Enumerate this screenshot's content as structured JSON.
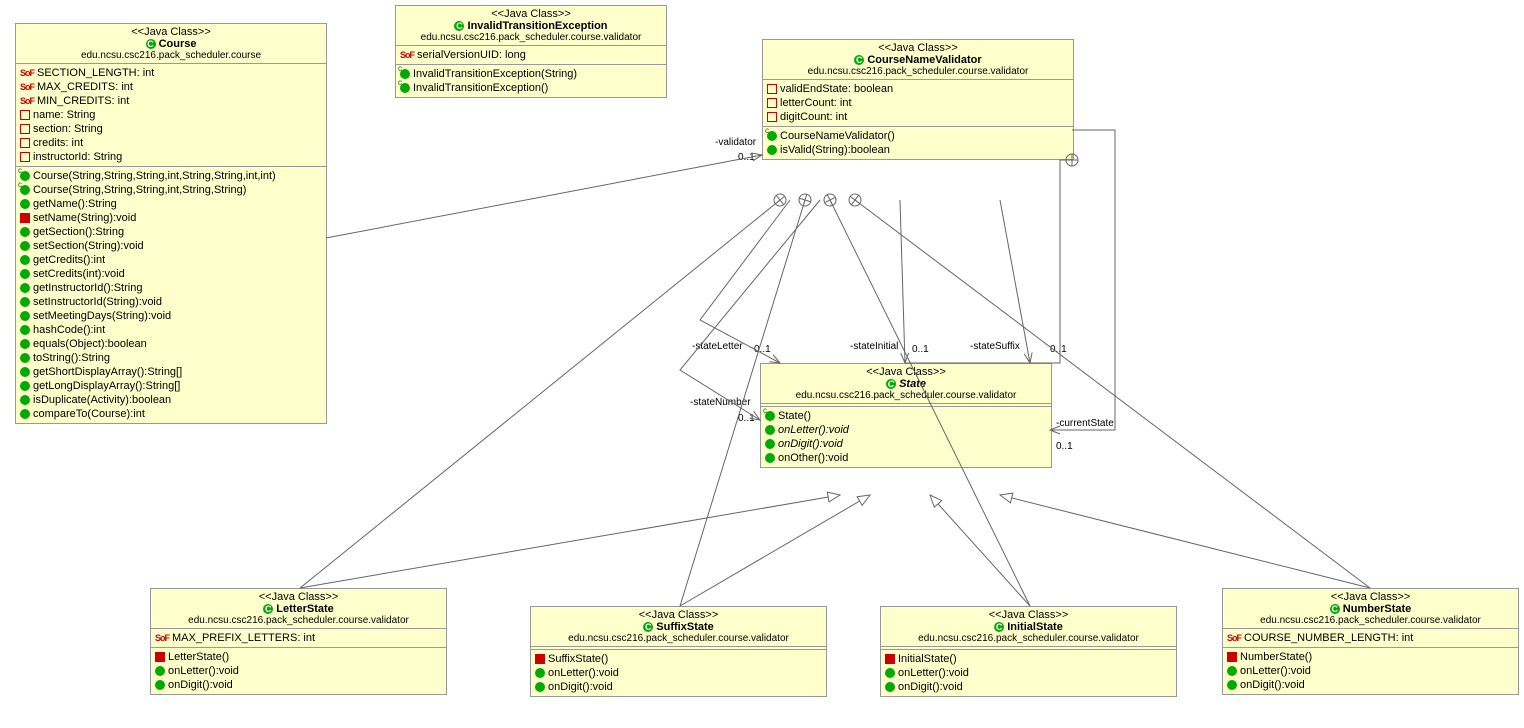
{
  "stereo": "<<Java Class>>",
  "pkg_course": "edu.ncsu.csc216.pack_scheduler.course",
  "pkg_val": "edu.ncsu.csc216.pack_scheduler.course.validator",
  "classes": {
    "course": {
      "name": "Course",
      "attrs": [
        {
          "vis": "sf",
          "text": "SECTION_LENGTH: int"
        },
        {
          "vis": "sf",
          "text": "MAX_CREDITS: int"
        },
        {
          "vis": "sf",
          "text": "MIN_CREDITS: int"
        },
        {
          "vis": "priv",
          "text": "name: String"
        },
        {
          "vis": "priv",
          "text": "section: String"
        },
        {
          "vis": "priv",
          "text": "credits: int"
        },
        {
          "vis": "priv",
          "text": "instructorId: String"
        }
      ],
      "ops": [
        {
          "vis": "ctor",
          "text": "Course(String,String,String,int,String,String,int,int)"
        },
        {
          "vis": "ctor",
          "text": "Course(String,String,String,int,String,String)"
        },
        {
          "vis": "pub",
          "text": "getName():String"
        },
        {
          "vis": "privf",
          "text": "setName(String):void"
        },
        {
          "vis": "pub",
          "text": "getSection():String"
        },
        {
          "vis": "pub",
          "text": "setSection(String):void"
        },
        {
          "vis": "pub",
          "text": "getCredits():int"
        },
        {
          "vis": "pub",
          "text": "setCredits(int):void"
        },
        {
          "vis": "pub",
          "text": "getInstructorId():String"
        },
        {
          "vis": "pub",
          "text": "setInstructorId(String):void"
        },
        {
          "vis": "pub",
          "text": "setMeetingDays(String):void"
        },
        {
          "vis": "pub",
          "text": "hashCode():int"
        },
        {
          "vis": "pub",
          "text": "equals(Object):boolean"
        },
        {
          "vis": "pub",
          "text": "toString():String"
        },
        {
          "vis": "pub",
          "text": "getShortDisplayArray():String[]"
        },
        {
          "vis": "pub",
          "text": "getLongDisplayArray():String[]"
        },
        {
          "vis": "pub",
          "text": "isDuplicate(Activity):boolean"
        },
        {
          "vis": "pub",
          "text": "compareTo(Course):int"
        }
      ]
    },
    "ite": {
      "name": "InvalidTransitionException",
      "attrs": [
        {
          "vis": "sf",
          "text": "serialVersionUID: long"
        }
      ],
      "ops": [
        {
          "vis": "ctor",
          "text": "InvalidTransitionException(String)"
        },
        {
          "vis": "ctor",
          "text": "InvalidTransitionException()"
        }
      ]
    },
    "cnv": {
      "name": "CourseNameValidator",
      "attrs": [
        {
          "vis": "priv",
          "text": "validEndState: boolean"
        },
        {
          "vis": "priv",
          "text": "letterCount: int"
        },
        {
          "vis": "priv",
          "text": "digitCount: int"
        }
      ],
      "ops": [
        {
          "vis": "ctor",
          "text": "CourseNameValidator()"
        },
        {
          "vis": "pub",
          "text": "isValid(String):boolean"
        }
      ]
    },
    "state": {
      "name": "State",
      "ops": [
        {
          "vis": "ctor",
          "text": "State()"
        },
        {
          "vis": "pub",
          "italic": true,
          "text": "onLetter():void"
        },
        {
          "vis": "pub",
          "italic": true,
          "text": "onDigit():void"
        },
        {
          "vis": "pub",
          "text": "onOther():void"
        }
      ]
    },
    "letter": {
      "name": "LetterState",
      "attrs": [
        {
          "vis": "sf",
          "text": "MAX_PREFIX_LETTERS: int"
        }
      ],
      "ops": [
        {
          "vis": "privf",
          "text": "LetterState()"
        },
        {
          "vis": "pub",
          "text": "onLetter():void"
        },
        {
          "vis": "pub",
          "text": "onDigit():void"
        }
      ]
    },
    "suffix": {
      "name": "SuffixState",
      "ops": [
        {
          "vis": "privf",
          "text": "SuffixState()"
        },
        {
          "vis": "pub",
          "text": "onLetter():void"
        },
        {
          "vis": "pub",
          "text": "onDigit():void"
        }
      ]
    },
    "initial": {
      "name": "InitialState",
      "ops": [
        {
          "vis": "privf",
          "text": "InitialState()"
        },
        {
          "vis": "pub",
          "text": "onLetter():void"
        },
        {
          "vis": "pub",
          "text": "onDigit():void"
        }
      ]
    },
    "number": {
      "name": "NumberState",
      "attrs": [
        {
          "vis": "sf",
          "text": "COURSE_NUMBER_LENGTH: int"
        }
      ],
      "ops": [
        {
          "vis": "privf",
          "text": "NumberState()"
        },
        {
          "vis": "pub",
          "text": "onLetter():void"
        },
        {
          "vis": "pub",
          "text": "onDigit():void"
        }
      ]
    }
  },
  "labels": {
    "validator": "-validator",
    "m01": "0..1",
    "stateLetter": "-stateLetter",
    "stateInitial": "-stateInitial",
    "stateSuffix": "-stateSuffix",
    "stateNumber": "-stateNumber",
    "currentState": "-currentState"
  }
}
